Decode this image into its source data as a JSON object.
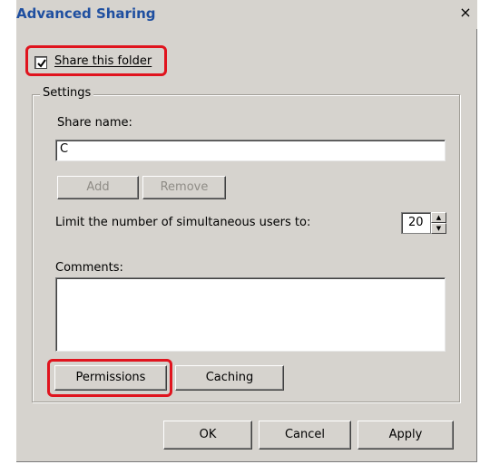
{
  "window": {
    "title": "Advanced Sharing",
    "close_glyph": "×"
  },
  "share": {
    "checkbox_label": "Share this folder",
    "checked": true
  },
  "settings": {
    "group_label": "Settings",
    "share_name_label": "Share name:",
    "share_name_value": "C",
    "add_button": "Add",
    "remove_button": "Remove",
    "limit_label": "Limit the number of simultaneous users to:",
    "limit_value": "20",
    "comments_label": "Comments:",
    "comments_value": "",
    "permissions_button": "Permissions",
    "caching_button": "Caching"
  },
  "footer": {
    "ok_button": "OK",
    "cancel_button": "Cancel",
    "apply_button": "Apply"
  },
  "highlight_color": "#e0141e"
}
